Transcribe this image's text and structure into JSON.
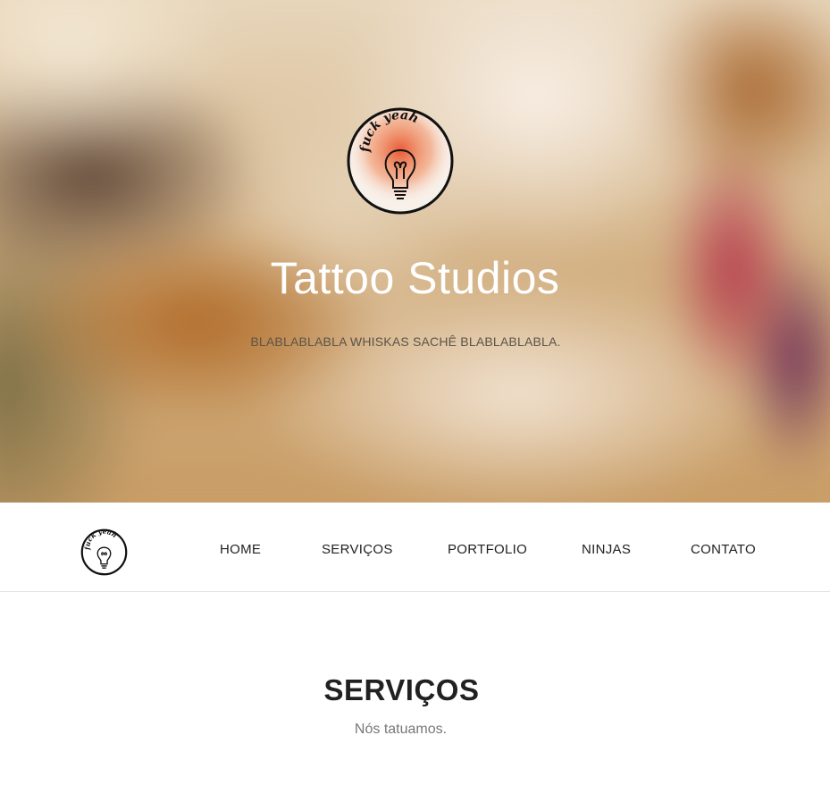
{
  "hero": {
    "logo_text": "fuck yeah",
    "title": "Tattoo Studios",
    "subtitle": "BLABLABLABLA WHISKAS SACHÊ BLABLABLABLA."
  },
  "nav": {
    "logo_text": "fuck yeah",
    "items": [
      {
        "label": "HOME"
      },
      {
        "label": "SERVIÇOS"
      },
      {
        "label": "PORTFOLIO"
      },
      {
        "label": "NINJAS"
      },
      {
        "label": "CONTATO"
      }
    ]
  },
  "services": {
    "title": "SERVIÇOS",
    "subtitle": "Nós tatuamos."
  },
  "colors": {
    "logo_accent": "#e8532a",
    "text_dark": "#212121",
    "text_muted": "#777777"
  },
  "icons": {
    "logo": "lightbulb-icon"
  }
}
